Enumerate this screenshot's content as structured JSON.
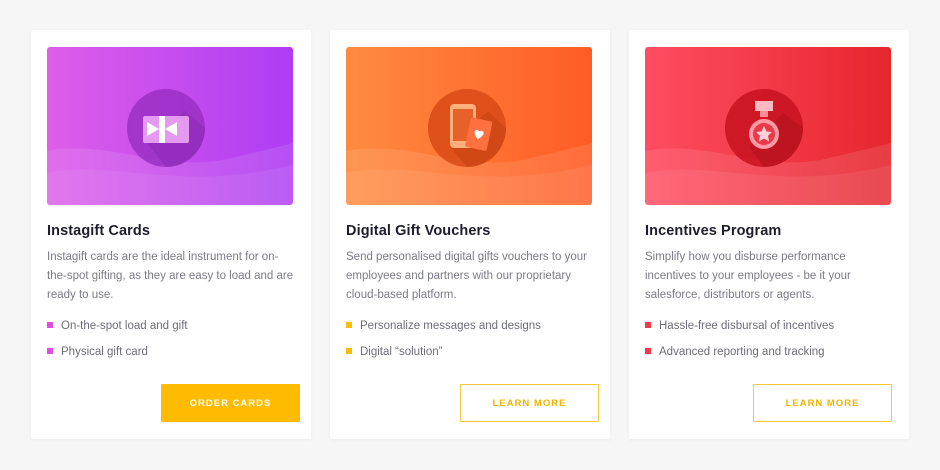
{
  "colors": {
    "page_bg": "#f6f6f7",
    "accent_yellow": "#ffbb00",
    "card1_gradient": [
      "#e05ee8",
      "#b13ff2"
    ],
    "card2_gradient": [
      "#ff8a3d",
      "#ff5f26"
    ],
    "card3_gradient": [
      "#ff4d63",
      "#e8262f"
    ],
    "card1_bullet": "#e24be0",
    "card2_bullet": "#ffbb00",
    "card3_bullet": "#f0394b"
  },
  "cards": [
    {
      "icon": "gift-card-icon",
      "title": "Instagift Cards",
      "description": "Instagift cards are the ideal instrument for on-the-spot gifting, as they are easy to load and are ready to use.",
      "bullets": [
        "On-the-spot load and gift",
        "Physical gift card"
      ],
      "button": "ORDER CARDS"
    },
    {
      "icon": "phone-voucher-icon",
      "title": "Digital Gift Vouchers",
      "description": "Send personalised digital gifts vouchers to your employees and partners with our proprietary cloud-based platform.",
      "bullets": [
        "Personalize messages and designs",
        "Digital “solution”"
      ],
      "button": "LEARN MORE"
    },
    {
      "icon": "medal-icon",
      "title": "Incentives Program",
      "description": "Simplify how you disburse performance incentives to your employees - be it your salesforce, distributors or agents.",
      "bullets": [
        "Hassle-free disbursal of incentives",
        "Advanced reporting and tracking"
      ],
      "button": "LEARN MORE"
    }
  ]
}
